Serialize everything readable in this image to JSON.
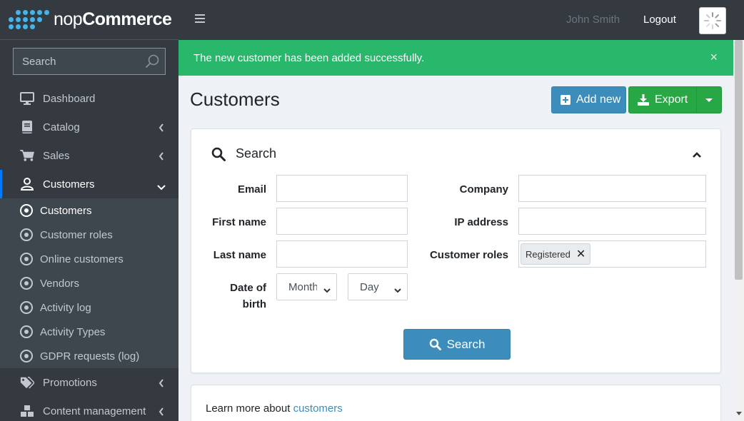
{
  "brand": {
    "name_bold": "nop",
    "name_rest": "Commerce"
  },
  "sidebar": {
    "search_placeholder": "Search",
    "items": [
      {
        "label": "Dashboard",
        "icon": "monitor-icon"
      },
      {
        "label": "Catalog",
        "icon": "book-icon"
      },
      {
        "label": "Sales",
        "icon": "cart-icon"
      },
      {
        "label": "Customers",
        "icon": "user-icon"
      },
      {
        "label": "Promotions",
        "icon": "tags-icon"
      },
      {
        "label": "Content management",
        "icon": "cubes-icon"
      }
    ],
    "customers_sub": [
      "Customers",
      "Customer roles",
      "Online customers",
      "Vendors",
      "Activity log",
      "Activity Types",
      "GDPR requests (log)"
    ]
  },
  "topbar": {
    "user": "John Smith",
    "logout": "Logout"
  },
  "alert": {
    "message": "The new customer has been added successfully.",
    "close": "×"
  },
  "page": {
    "title": "Customers",
    "add_new": "Add new",
    "export": "Export"
  },
  "search_panel": {
    "title": "Search",
    "labels": {
      "email": "Email",
      "first_name": "First name",
      "last_name": "Last name",
      "date_of_birth_1": "Date of",
      "date_of_birth_2": "birth",
      "company": "Company",
      "ip_address": "IP address",
      "customer_roles": "Customer roles"
    },
    "values": {
      "email": "",
      "first_name": "",
      "last_name": "",
      "company": "",
      "ip_address": ""
    },
    "dob_month": "Month",
    "dob_day": "Day",
    "roles_selected": [
      "Registered"
    ],
    "search_button": "Search"
  },
  "learn_more": {
    "text": "Learn more about ",
    "link": "customers"
  },
  "colors": {
    "accent": "#3c8dbc",
    "success": "#28b76b",
    "export": "#28a745",
    "sidebar": "#343a40"
  }
}
